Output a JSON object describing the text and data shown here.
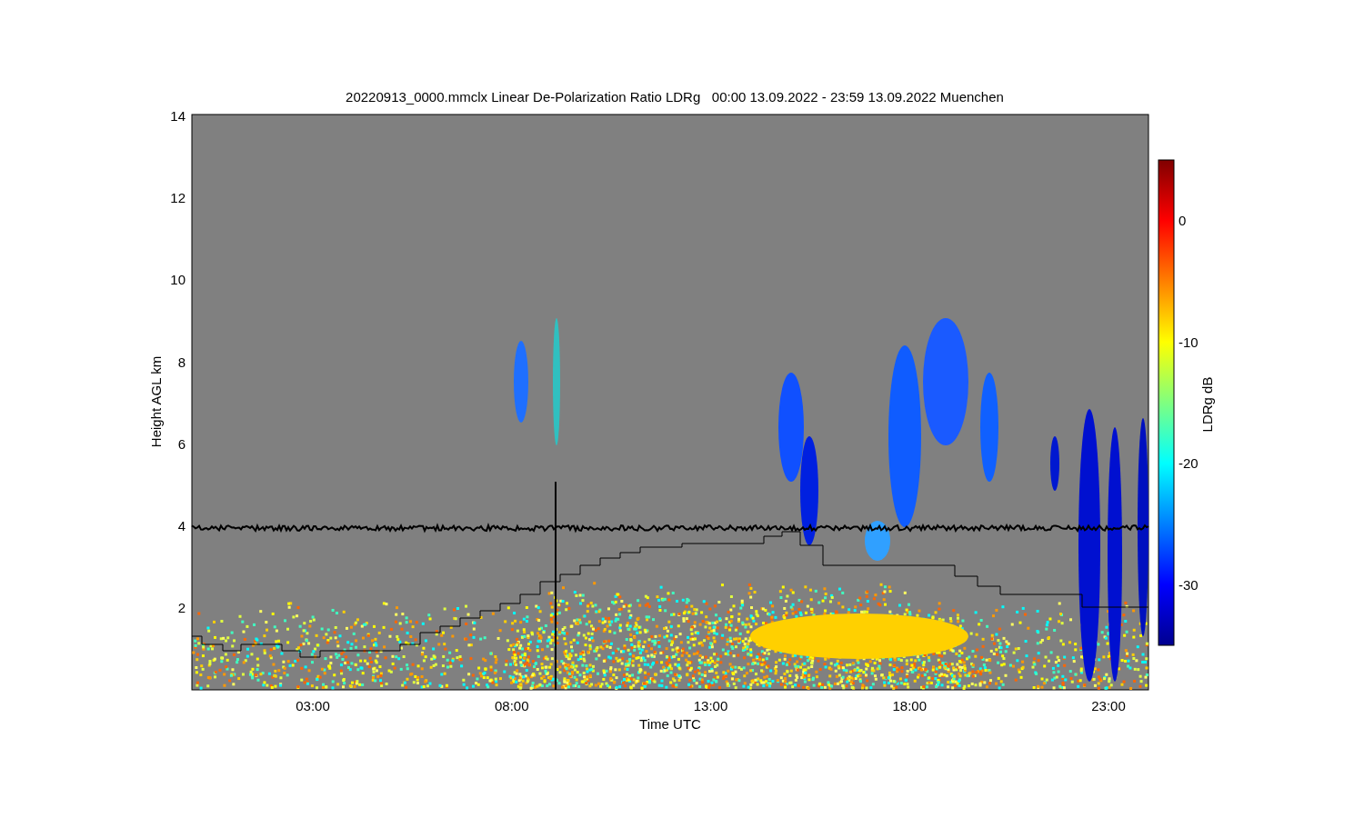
{
  "title": "20220913_0000.mmclx Linear De-Polarization Ratio LDRg   00:00 13.09.2022 - 23:59 13.09.2022 Muenchen",
  "y_axis": {
    "label": "Height AGL km",
    "ticks": [
      "14",
      "12",
      "10",
      "8",
      "6",
      "4",
      "2"
    ]
  },
  "x_axis": {
    "label": "Time UTC",
    "ticks": [
      "03:00",
      "08:00",
      "13:00",
      "18:00",
      "23:00"
    ]
  },
  "colorbar": {
    "label": "LDRg dB",
    "ticks": [
      "0",
      "-10",
      "-20",
      "-30"
    ]
  }
}
